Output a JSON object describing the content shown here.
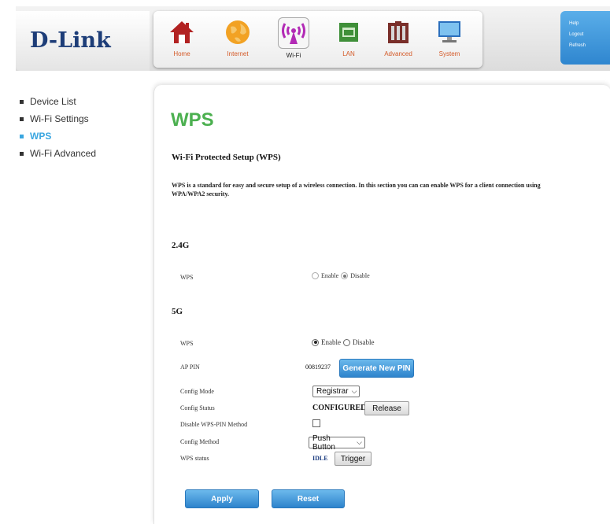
{
  "brand": {
    "logo": "D-Link"
  },
  "nav": {
    "items": [
      {
        "label": "Home",
        "icon": "home-icon"
      },
      {
        "label": "Internet",
        "icon": "globe-icon"
      },
      {
        "label": "Wi-Fi",
        "icon": "wifi-icon"
      },
      {
        "label": "LAN",
        "icon": "lan-icon"
      },
      {
        "label": "Advanced",
        "icon": "tools-icon"
      },
      {
        "label": "System",
        "icon": "monitor-icon"
      }
    ],
    "active": "Wi-Fi"
  },
  "top_links": {
    "help": "Help",
    "logout": "Logout",
    "refresh": "Refresh"
  },
  "sidebar": {
    "items": [
      {
        "label": "Device List"
      },
      {
        "label": "Wi-Fi Settings"
      },
      {
        "label": "WPS"
      },
      {
        "label": "Wi-Fi Advanced"
      }
    ],
    "active": "WPS"
  },
  "page": {
    "title": "WPS",
    "section_title": "Wi-Fi Protected Setup (WPS)",
    "description": "WPS is a standard for easy and secure setup of a wireless connection. In this section you can can enable WPS for a client connection using WPA/WPA2 security."
  },
  "band24": {
    "title": "2.4G",
    "wps_label": "WPS",
    "enable_label": "Enable",
    "disable_label": "Disable",
    "selected": "Disable"
  },
  "band5": {
    "title": "5G",
    "wps_label": "WPS",
    "enable_label": "Enable",
    "disable_label": "Disable",
    "selected": "Enable",
    "ap_pin_label": "AP PIN",
    "ap_pin_value": "00819237",
    "generate_button": "Generate New PIN",
    "config_mode_label": "Config Mode",
    "config_mode_value": "Registrar",
    "config_status_label": "Config Status",
    "config_status_value": "CONFIGURED",
    "release_button": "Release",
    "disable_pin_label": "Disable WPS-PIN Method",
    "disable_pin_checked": false,
    "config_method_label": "Config Method",
    "config_method_value": "Push Button",
    "wps_status_label": "WPS status",
    "wps_status_value": "IDLE",
    "trigger_button": "Trigger"
  },
  "actions": {
    "apply": "Apply",
    "reset": "Reset"
  },
  "colors": {
    "title_green": "#4cb050",
    "accent_blue": "#3aa6e0",
    "logo_navy": "#1d3d78",
    "nav_orange": "#d45a28"
  }
}
